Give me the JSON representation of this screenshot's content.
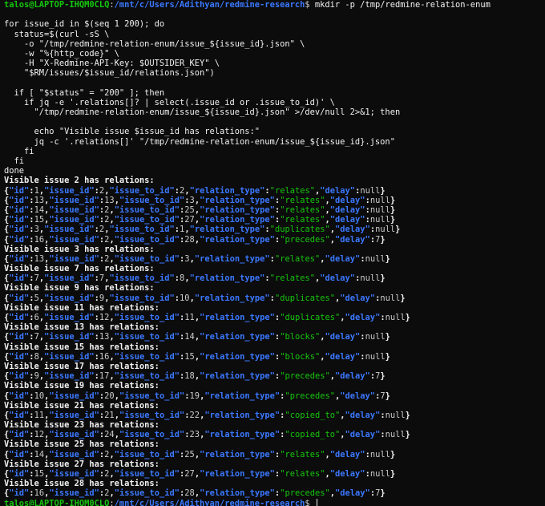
{
  "prompt": {
    "user_host": "talos@LAPTOP-IHQM0CLQ",
    "separator": ":",
    "path": "/mnt/c/Users/Adithyan/redmine-research",
    "symbol": "$"
  },
  "first_command": " mkdir -p /tmp/redmine-relation-enum",
  "script_lines": [
    "",
    "for issue_id in $(seq 1 200); do",
    "  status=$(curl -sS \\",
    "    -o \"/tmp/redmine-relation-enum/issue_${issue_id}.json\" \\",
    "    -w \"%{http_code}\" \\",
    "    -H \"X-Redmine-API-Key: $OUTSIDER_KEY\" \\",
    "    \"$RM/issues/$issue_id/relations.json\")",
    "",
    "  if [ \"$status\" = \"200\" ]; then",
    "    if jq -e '.relations[]? | select(.issue_id or .issue_to_id)' \\",
    "      \"/tmp/redmine-relation-enum/issue_${issue_id}.json\" >/dev/null 2>&1; then",
    "",
    "      echo \"Visible issue $issue_id has relations:\"",
    "      jq -c '.relations[]' \"/tmp/redmine-relation-enum/issue_${issue_id}.json\"",
    "    fi",
    "  fi",
    "done"
  ],
  "output": [
    {
      "header": "Visible issue 2 has relations:",
      "relations": [
        {
          "id": "1",
          "issue_id": "2",
          "issue_to_id": "2",
          "relation_type": "\"relates\"",
          "delay": "null"
        },
        {
          "id": "13",
          "issue_id": "13",
          "issue_to_id": "3",
          "relation_type": "\"relates\"",
          "delay": "null"
        },
        {
          "id": "14",
          "issue_id": "2",
          "issue_to_id": "25",
          "relation_type": "\"relates\"",
          "delay": "null"
        },
        {
          "id": "15",
          "issue_id": "2",
          "issue_to_id": "27",
          "relation_type": "\"relates\"",
          "delay": "null"
        },
        {
          "id": "3",
          "issue_id": "2",
          "issue_to_id": "1",
          "relation_type": "\"duplicates\"",
          "delay": "null"
        },
        {
          "id": "16",
          "issue_id": "2",
          "issue_to_id": "28",
          "relation_type": "\"precedes\"",
          "delay": "7"
        }
      ]
    },
    {
      "header": "Visible issue 3 has relations:",
      "relations": [
        {
          "id": "13",
          "issue_id": "2",
          "issue_to_id": "3",
          "relation_type": "\"relates\"",
          "delay": "null"
        }
      ]
    },
    {
      "header": "Visible issue 7 has relations:",
      "relations": [
        {
          "id": "7",
          "issue_id": "7",
          "issue_to_id": "8",
          "relation_type": "\"relates\"",
          "delay": "null"
        }
      ]
    },
    {
      "header": "Visible issue 9 has relations:",
      "relations": [
        {
          "id": "5",
          "issue_id": "9",
          "issue_to_id": "10",
          "relation_type": "\"duplicates\"",
          "delay": "null"
        }
      ]
    },
    {
      "header": "Visible issue 11 has relations:",
      "relations": [
        {
          "id": "6",
          "issue_id": "12",
          "issue_to_id": "11",
          "relation_type": "\"duplicates\"",
          "delay": "null"
        }
      ]
    },
    {
      "header": "Visible issue 13 has relations:",
      "relations": [
        {
          "id": "7",
          "issue_id": "13",
          "issue_to_id": "14",
          "relation_type": "\"blocks\"",
          "delay": "null"
        }
      ]
    },
    {
      "header": "Visible issue 15 has relations:",
      "relations": [
        {
          "id": "8",
          "issue_id": "16",
          "issue_to_id": "15",
          "relation_type": "\"blocks\"",
          "delay": "null"
        }
      ]
    },
    {
      "header": "Visible issue 17 has relations:",
      "relations": [
        {
          "id": "9",
          "issue_id": "17",
          "issue_to_id": "18",
          "relation_type": "\"precedes\"",
          "delay": "7"
        }
      ]
    },
    {
      "header": "Visible issue 19 has relations:",
      "relations": [
        {
          "id": "10",
          "issue_id": "20",
          "issue_to_id": "19",
          "relation_type": "\"precedes\"",
          "delay": "7"
        }
      ]
    },
    {
      "header": "Visible issue 21 has relations:",
      "relations": [
        {
          "id": "11",
          "issue_id": "21",
          "issue_to_id": "22",
          "relation_type": "\"copied_to\"",
          "delay": "null"
        }
      ]
    },
    {
      "header": "Visible issue 23 has relations:",
      "relations": [
        {
          "id": "12",
          "issue_id": "24",
          "issue_to_id": "23",
          "relation_type": "\"copied_to\"",
          "delay": "null"
        }
      ]
    },
    {
      "header": "Visible issue 25 has relations:",
      "relations": [
        {
          "id": "14",
          "issue_id": "2",
          "issue_to_id": "25",
          "relation_type": "\"relates\"",
          "delay": "null"
        }
      ]
    },
    {
      "header": "Visible issue 27 has relations:",
      "relations": [
        {
          "id": "15",
          "issue_id": "2",
          "issue_to_id": "27",
          "relation_type": "\"relates\"",
          "delay": "null"
        }
      ]
    },
    {
      "header": "Visible issue 28 has relations:",
      "relations": [
        {
          "id": "16",
          "issue_id": "2",
          "issue_to_id": "28",
          "relation_type": "\"precedes\"",
          "delay": "7"
        }
      ]
    }
  ],
  "json_keys": {
    "open": "{",
    "close": "}",
    "comma": ",",
    "colon": ":",
    "id": "\"id\"",
    "issue_id": "\"issue_id\"",
    "issue_to_id": "\"issue_to_id\"",
    "relation_type": "\"relation_type\"",
    "delay": "\"delay\""
  },
  "colors": {
    "background": "#0c0c0c",
    "prompt_user": "#16c60c",
    "prompt_path": "#3b78ff",
    "json_key": "#3b78ff",
    "json_string": "#16c60c",
    "text": "#cccccc"
  }
}
